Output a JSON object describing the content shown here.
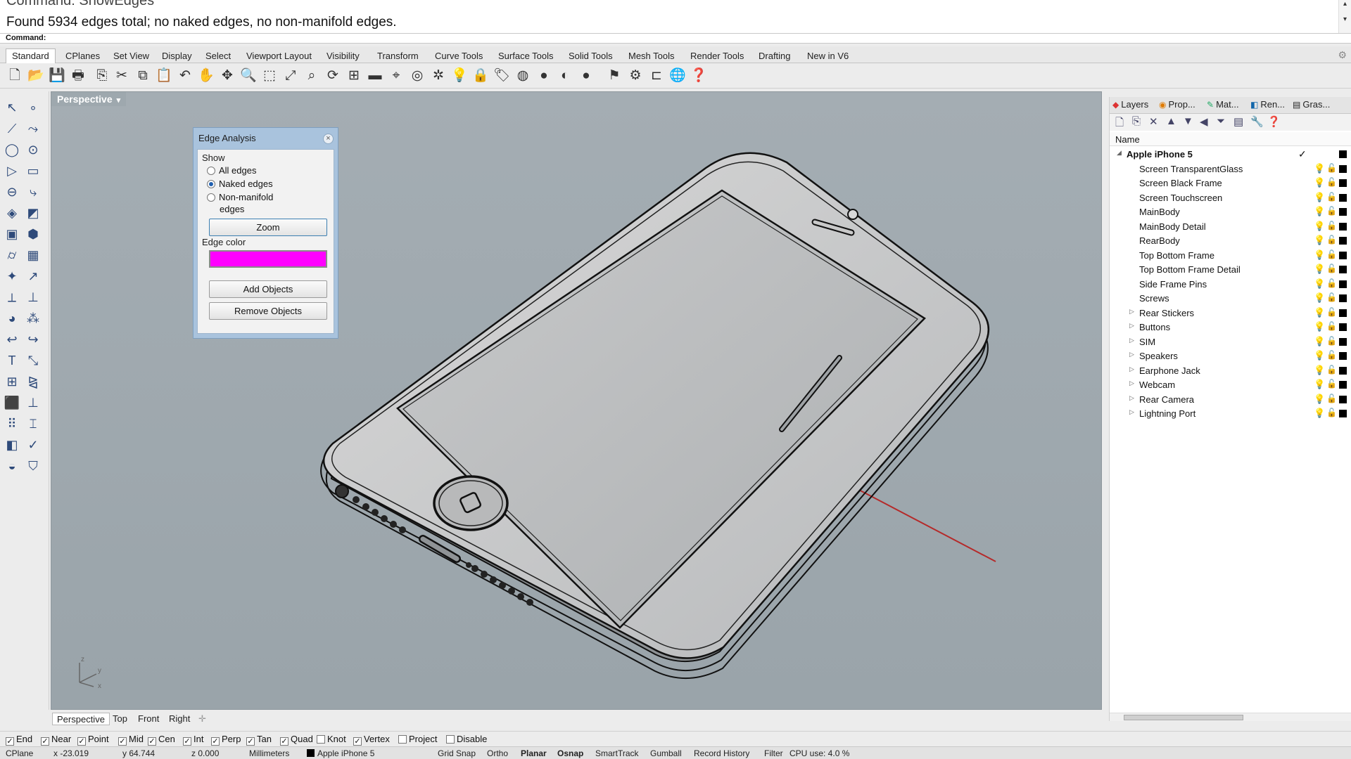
{
  "command": {
    "previous": "Command: ShowEdges",
    "result": "Found 5934 edges total; no naked edges, no non-manifold edges.",
    "prompt_label": "Command:",
    "input_value": ""
  },
  "tabs": [
    "Standard",
    "CPlanes",
    "Set View",
    "Display",
    "Select",
    "Viewport Layout",
    "Visibility",
    "Transform",
    "Curve Tools",
    "Surface Tools",
    "Solid Tools",
    "Mesh Tools",
    "Render Tools",
    "Drafting",
    "New in V6"
  ],
  "viewport": {
    "title": "Perspective",
    "axes_label": "z y x"
  },
  "edge_dialog": {
    "title": "Edge Analysis",
    "show_label": "Show",
    "options": [
      "All edges",
      "Naked edges",
      "Non-manifold",
      "edges"
    ],
    "selected": "Naked edges",
    "zoom_button": "Zoom",
    "edge_color_label": "Edge color",
    "edge_color": "#ff00ff",
    "add_button": "Add Objects",
    "remove_button": "Remove Objects"
  },
  "panel": {
    "tabs": [
      "Layers",
      "Prop...",
      "Mat...",
      "Ren...",
      "Gras..."
    ],
    "name_header": "Name",
    "parent_layer": "Apple iPhone 5",
    "layers": [
      "Screen TransparentGlass",
      "Screen Black Frame",
      "Screen Touchscreen",
      "MainBody",
      "MainBody Detail",
      "RearBody",
      "Top Bottom Frame",
      "Top Bottom Frame Detail",
      "Side Frame Pins",
      "Screws",
      "Rear Stickers",
      "Buttons",
      "SIM",
      "Speakers",
      "Earphone Jack",
      "Webcam",
      "Rear Camera",
      "Lightning Port"
    ]
  },
  "viewport_tabs": [
    "Perspective",
    "Top",
    "Front",
    "Right"
  ],
  "osnaps": [
    {
      "label": "End",
      "checked": true
    },
    {
      "label": "Near",
      "checked": true
    },
    {
      "label": "Point",
      "checked": true
    },
    {
      "label": "Mid",
      "checked": true
    },
    {
      "label": "Cen",
      "checked": true
    },
    {
      "label": "Int",
      "checked": true
    },
    {
      "label": "Perp",
      "checked": true
    },
    {
      "label": "Tan",
      "checked": true
    },
    {
      "label": "Quad",
      "checked": true
    },
    {
      "label": "Knot",
      "checked": false
    },
    {
      "label": "Vertex",
      "checked": true
    },
    {
      "label": "Project",
      "checked": false
    },
    {
      "label": "Disable",
      "checked": false
    }
  ],
  "status": {
    "cplane": "CPlane",
    "x": "x -23.019",
    "y": "y 64.744",
    "z": "z 0.000",
    "units": "Millimeters",
    "layer": "Apple iPhone 5",
    "grid_snap": "Grid Snap",
    "ortho": "Ortho",
    "planar": "Planar",
    "osnap": "Osnap",
    "smarttrack": "SmartTrack",
    "gumball": "Gumball",
    "record_history": "Record History",
    "filter": "Filter",
    "cpu": "CPU use: 4.0 %"
  }
}
